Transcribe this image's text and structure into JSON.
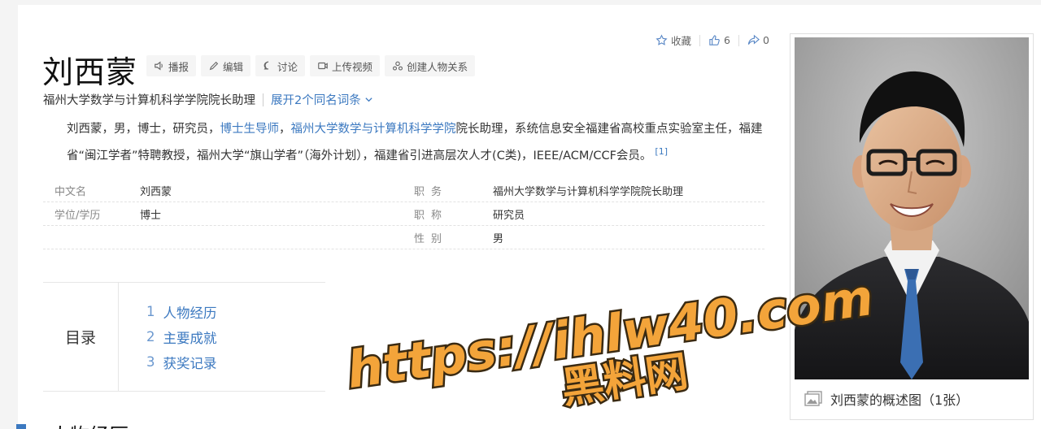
{
  "entry": {
    "title": "刘西蒙",
    "actions": [
      {
        "label": "播报",
        "icon": "speaker-icon"
      },
      {
        "label": "编辑",
        "icon": "pencil-icon"
      },
      {
        "label": "讨论",
        "icon": "chat-icon"
      },
      {
        "label": "上传视频",
        "icon": "video-icon"
      },
      {
        "label": "创建人物关系",
        "icon": "relation-icon"
      }
    ],
    "toolbar": {
      "favorite": "收藏",
      "likes": "6",
      "shares": "0"
    },
    "subtitle": "福州大学数学与计算机科学学院院长助理",
    "expand_label": "展开2个同名词条"
  },
  "summary": {
    "p1_start": "刘西蒙，男，博士，研究员，",
    "link1": "博士生导师",
    "p1_mid": "，",
    "link2": "福州大学数学与计算机科学学院",
    "p1_end": "院长助理，系统信息安全福建省高校重点实验室主任，福建省“闽江学者”特聘教授，福州大学“旗山学者”（海外计划），福建省引进高层次人才(C类)，IEEE/ACM/CCF会员。",
    "ref": "[1]"
  },
  "info": {
    "rows": [
      {
        "k1": "中文名",
        "v1": "刘西蒙",
        "k2": "职务",
        "v2": "福州大学数学与计算机科学学院院长助理"
      },
      {
        "k1": "学位/学历",
        "v1": "博士",
        "k2": "职称",
        "v2": "研究员"
      },
      {
        "k1": "",
        "v1": "",
        "k2": "性别",
        "v2": "男"
      }
    ]
  },
  "catalog": {
    "title": "目录",
    "items": [
      {
        "num": "1",
        "label": "人物经历"
      },
      {
        "num": "2",
        "label": "主要成就"
      },
      {
        "num": "3",
        "label": "获奖记录"
      }
    ]
  },
  "section": {
    "title": "人物经历"
  },
  "photo": {
    "caption": "刘西蒙的概述图（1张）"
  },
  "watermark": {
    "line1": "https://ihlw40.com",
    "line2": "黑料网"
  },
  "colors": {
    "link": "#3c79c0",
    "watermark_fill": "#f3a43a",
    "watermark_stroke": "#3a2a12"
  }
}
